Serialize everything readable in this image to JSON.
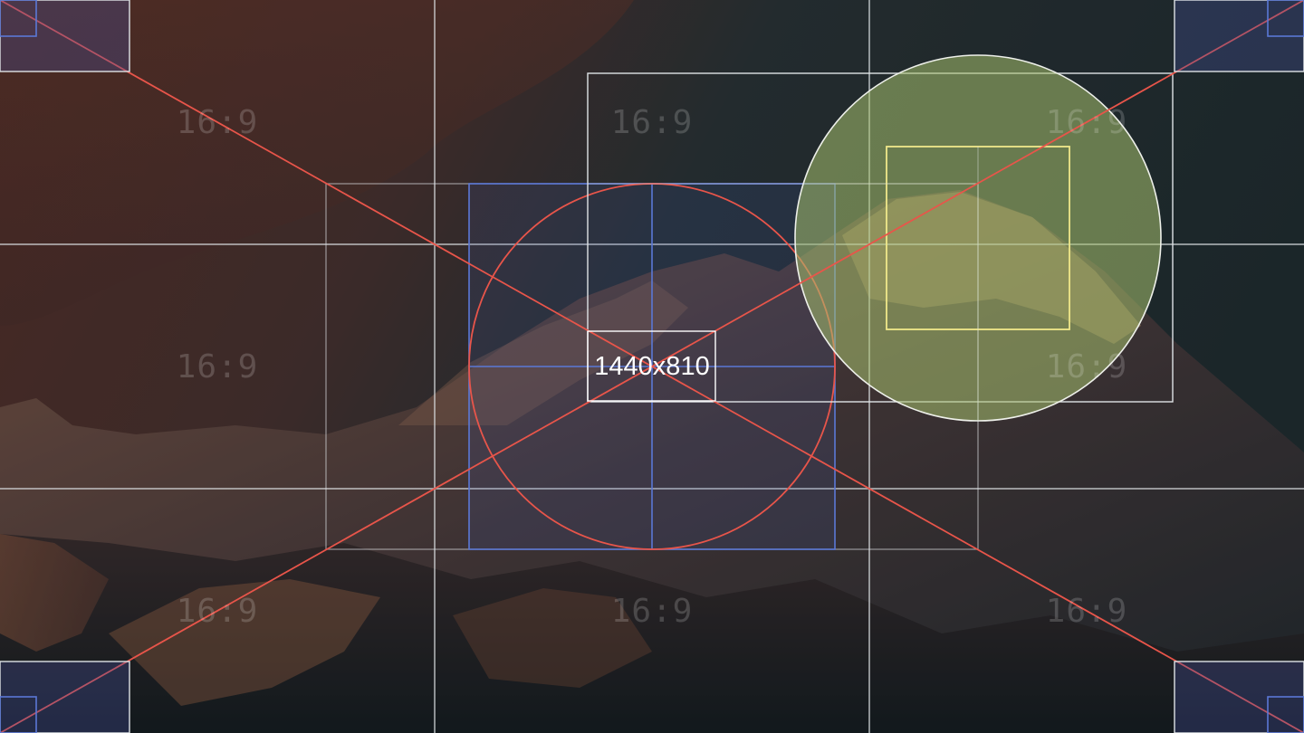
{
  "resolution_label": "1440x810",
  "aspect_ratio_label": "16:9",
  "colors": {
    "grid_line": "#dfe3e6",
    "diagonal": "#e8554a",
    "blue_guide": "#5b78d6",
    "yellow_guide": "#f0e88a",
    "circle_fill": "#a6bf6e",
    "background_dark": "#1b2226",
    "background_warm": "#5a2f26"
  },
  "background": {
    "description_icon": "mountain-photo"
  }
}
